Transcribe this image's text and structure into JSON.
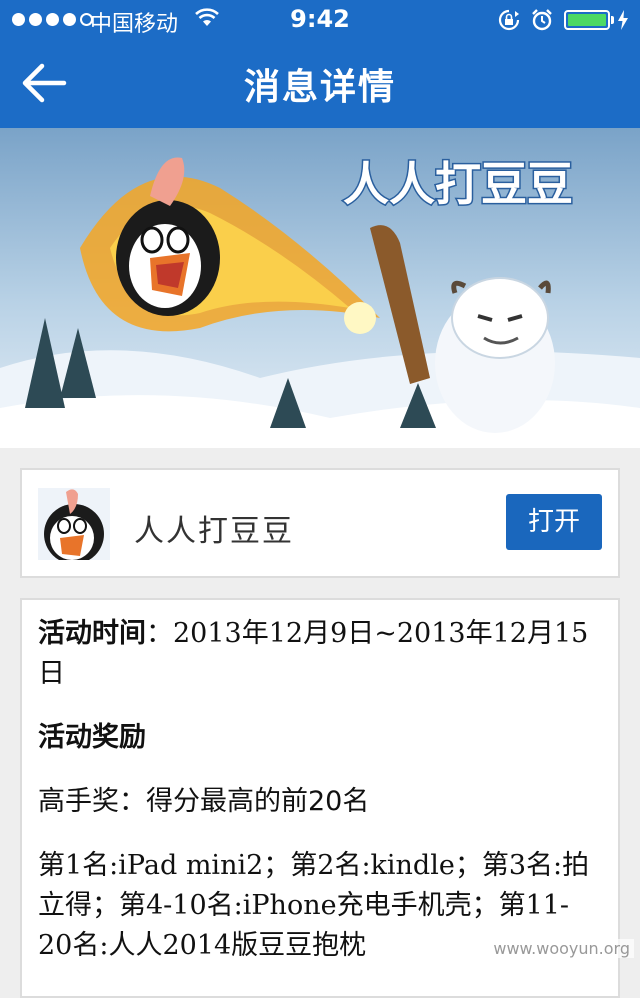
{
  "status_bar": {
    "carrier": "中国移动",
    "time": "9:42",
    "battery_level": 1.0
  },
  "nav": {
    "title": "消息详情"
  },
  "banner": {
    "game_logo_text": "人人打豆豆"
  },
  "app": {
    "name": "人人打豆豆",
    "open_label": "打开"
  },
  "detail": {
    "time_label": "活动时间",
    "time_sep": "：",
    "time_value": "2013年12月9日~2013年12月15日",
    "reward_heading": "活动奖励",
    "prize_label": "高手奖",
    "prize_sep": "：",
    "prize_value": "得分最高的前20名",
    "prize_list": "第1名:iPad mini2；第2名:kindle；第3名:拍立得；第4-10名:iPhone充电手机壳；第11-20名:人人2014版豆豆抱枕"
  },
  "watermark": "www.wooyun.org",
  "colors": {
    "nav_blue": "#1c6cc6",
    "button_blue": "#1a67bd",
    "battery_green": "#4cd964"
  }
}
